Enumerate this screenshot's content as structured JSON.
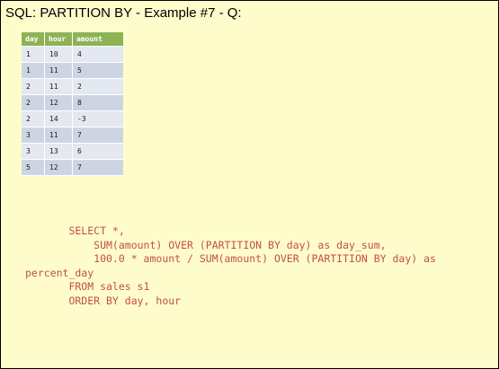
{
  "slide": {
    "title": "SQL: PARTITION BY - Example #7 - Q:"
  },
  "table": {
    "headers": [
      "day",
      "hour",
      "amount"
    ],
    "rows": [
      [
        "1",
        "10",
        "4"
      ],
      [
        "1",
        "11",
        "5"
      ],
      [
        "2",
        "11",
        "2"
      ],
      [
        "2",
        "12",
        "8"
      ],
      [
        "2",
        "14",
        "-3"
      ],
      [
        "3",
        "11",
        "7"
      ],
      [
        "3",
        "13",
        "6"
      ],
      [
        "5",
        "12",
        "7"
      ]
    ]
  },
  "code": {
    "lines": [
      "       SELECT *,",
      "           SUM(amount) OVER (PARTITION BY day) as day_sum,",
      "           100.0 * amount / SUM(amount) OVER (PARTITION BY day) as",
      "percent_day",
      "       FROM sales s1",
      "       ORDER BY day, hour"
    ]
  },
  "colors": {
    "background": "#fffccb",
    "table_header": "#8db356",
    "row_light": "#e3e8f1",
    "row_dark": "#cdd5e5",
    "code_text": "#c0504d"
  }
}
